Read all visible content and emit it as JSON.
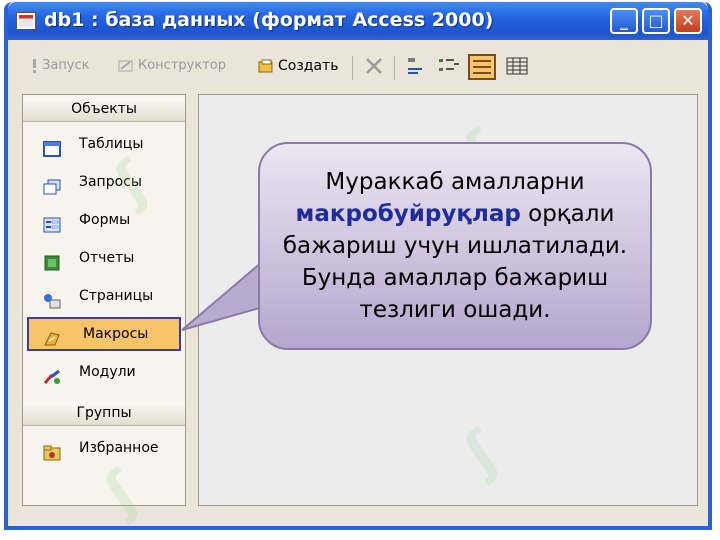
{
  "window": {
    "title": "db1 : база данных (формат Access 2000)",
    "controls": {
      "minimize": "_",
      "maximize": "□",
      "close": "✕"
    }
  },
  "toolbar": {
    "run_label": "Запуск",
    "design_label": "Конструктор",
    "create_label": "Создать"
  },
  "sidebar": {
    "objects_header": "Объекты",
    "items": [
      {
        "label": "Таблицы",
        "icon": "table-icon"
      },
      {
        "label": "Запросы",
        "icon": "query-icon"
      },
      {
        "label": "Формы",
        "icon": "form-icon"
      },
      {
        "label": "Отчеты",
        "icon": "report-icon"
      },
      {
        "label": "Страницы",
        "icon": "page-icon"
      },
      {
        "label": "Макросы",
        "icon": "macro-icon",
        "selected": true
      },
      {
        "label": "Модули",
        "icon": "module-icon"
      }
    ],
    "groups_header": "Группы",
    "group_items": [
      {
        "label": "Избранное",
        "icon": "favorites-folder-icon"
      }
    ]
  },
  "callout": {
    "line1": "Мураккаб амалларни",
    "highlight": "макробуйруқлар",
    "line2_rest": " орқали",
    "line3": "бажариш учун ишлатилади.",
    "line4": "Бунда амаллар бажариш",
    "line5": "тезлиги ошади."
  },
  "colors": {
    "titlebar": "#2563e0",
    "selected_item": "#f7c46a",
    "highlight_text": "#1f2d9c",
    "callout_fill": "#b5a6cd"
  }
}
